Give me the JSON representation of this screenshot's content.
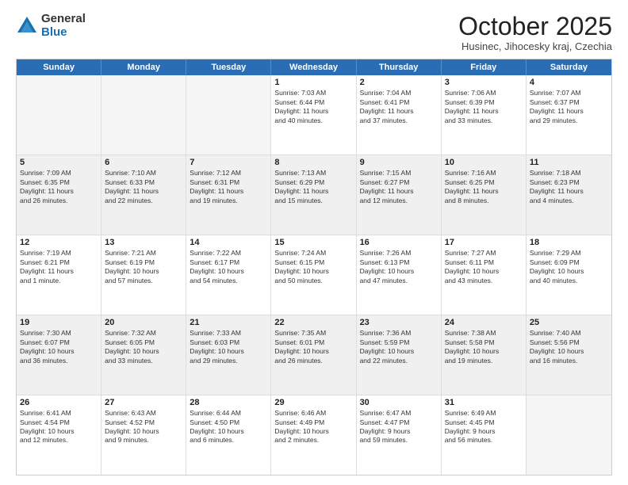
{
  "logo": {
    "general": "General",
    "blue": "Blue"
  },
  "header": {
    "month": "October 2025",
    "location": "Husinec, Jihocesky kraj, Czechia"
  },
  "weekdays": [
    "Sunday",
    "Monday",
    "Tuesday",
    "Wednesday",
    "Thursday",
    "Friday",
    "Saturday"
  ],
  "rows": [
    [
      {
        "day": "",
        "text": ""
      },
      {
        "day": "",
        "text": ""
      },
      {
        "day": "",
        "text": ""
      },
      {
        "day": "1",
        "text": "Sunrise: 7:03 AM\nSunset: 6:44 PM\nDaylight: 11 hours\nand 40 minutes."
      },
      {
        "day": "2",
        "text": "Sunrise: 7:04 AM\nSunset: 6:41 PM\nDaylight: 11 hours\nand 37 minutes."
      },
      {
        "day": "3",
        "text": "Sunrise: 7:06 AM\nSunset: 6:39 PM\nDaylight: 11 hours\nand 33 minutes."
      },
      {
        "day": "4",
        "text": "Sunrise: 7:07 AM\nSunset: 6:37 PM\nDaylight: 11 hours\nand 29 minutes."
      }
    ],
    [
      {
        "day": "5",
        "text": "Sunrise: 7:09 AM\nSunset: 6:35 PM\nDaylight: 11 hours\nand 26 minutes."
      },
      {
        "day": "6",
        "text": "Sunrise: 7:10 AM\nSunset: 6:33 PM\nDaylight: 11 hours\nand 22 minutes."
      },
      {
        "day": "7",
        "text": "Sunrise: 7:12 AM\nSunset: 6:31 PM\nDaylight: 11 hours\nand 19 minutes."
      },
      {
        "day": "8",
        "text": "Sunrise: 7:13 AM\nSunset: 6:29 PM\nDaylight: 11 hours\nand 15 minutes."
      },
      {
        "day": "9",
        "text": "Sunrise: 7:15 AM\nSunset: 6:27 PM\nDaylight: 11 hours\nand 12 minutes."
      },
      {
        "day": "10",
        "text": "Sunrise: 7:16 AM\nSunset: 6:25 PM\nDaylight: 11 hours\nand 8 minutes."
      },
      {
        "day": "11",
        "text": "Sunrise: 7:18 AM\nSunset: 6:23 PM\nDaylight: 11 hours\nand 4 minutes."
      }
    ],
    [
      {
        "day": "12",
        "text": "Sunrise: 7:19 AM\nSunset: 6:21 PM\nDaylight: 11 hours\nand 1 minute."
      },
      {
        "day": "13",
        "text": "Sunrise: 7:21 AM\nSunset: 6:19 PM\nDaylight: 10 hours\nand 57 minutes."
      },
      {
        "day": "14",
        "text": "Sunrise: 7:22 AM\nSunset: 6:17 PM\nDaylight: 10 hours\nand 54 minutes."
      },
      {
        "day": "15",
        "text": "Sunrise: 7:24 AM\nSunset: 6:15 PM\nDaylight: 10 hours\nand 50 minutes."
      },
      {
        "day": "16",
        "text": "Sunrise: 7:26 AM\nSunset: 6:13 PM\nDaylight: 10 hours\nand 47 minutes."
      },
      {
        "day": "17",
        "text": "Sunrise: 7:27 AM\nSunset: 6:11 PM\nDaylight: 10 hours\nand 43 minutes."
      },
      {
        "day": "18",
        "text": "Sunrise: 7:29 AM\nSunset: 6:09 PM\nDaylight: 10 hours\nand 40 minutes."
      }
    ],
    [
      {
        "day": "19",
        "text": "Sunrise: 7:30 AM\nSunset: 6:07 PM\nDaylight: 10 hours\nand 36 minutes."
      },
      {
        "day": "20",
        "text": "Sunrise: 7:32 AM\nSunset: 6:05 PM\nDaylight: 10 hours\nand 33 minutes."
      },
      {
        "day": "21",
        "text": "Sunrise: 7:33 AM\nSunset: 6:03 PM\nDaylight: 10 hours\nand 29 minutes."
      },
      {
        "day": "22",
        "text": "Sunrise: 7:35 AM\nSunset: 6:01 PM\nDaylight: 10 hours\nand 26 minutes."
      },
      {
        "day": "23",
        "text": "Sunrise: 7:36 AM\nSunset: 5:59 PM\nDaylight: 10 hours\nand 22 minutes."
      },
      {
        "day": "24",
        "text": "Sunrise: 7:38 AM\nSunset: 5:58 PM\nDaylight: 10 hours\nand 19 minutes."
      },
      {
        "day": "25",
        "text": "Sunrise: 7:40 AM\nSunset: 5:56 PM\nDaylight: 10 hours\nand 16 minutes."
      }
    ],
    [
      {
        "day": "26",
        "text": "Sunrise: 6:41 AM\nSunset: 4:54 PM\nDaylight: 10 hours\nand 12 minutes."
      },
      {
        "day": "27",
        "text": "Sunrise: 6:43 AM\nSunset: 4:52 PM\nDaylight: 10 hours\nand 9 minutes."
      },
      {
        "day": "28",
        "text": "Sunrise: 6:44 AM\nSunset: 4:50 PM\nDaylight: 10 hours\nand 6 minutes."
      },
      {
        "day": "29",
        "text": "Sunrise: 6:46 AM\nSunset: 4:49 PM\nDaylight: 10 hours\nand 2 minutes."
      },
      {
        "day": "30",
        "text": "Sunrise: 6:47 AM\nSunset: 4:47 PM\nDaylight: 9 hours\nand 59 minutes."
      },
      {
        "day": "31",
        "text": "Sunrise: 6:49 AM\nSunset: 4:45 PM\nDaylight: 9 hours\nand 56 minutes."
      },
      {
        "day": "",
        "text": ""
      }
    ]
  ]
}
